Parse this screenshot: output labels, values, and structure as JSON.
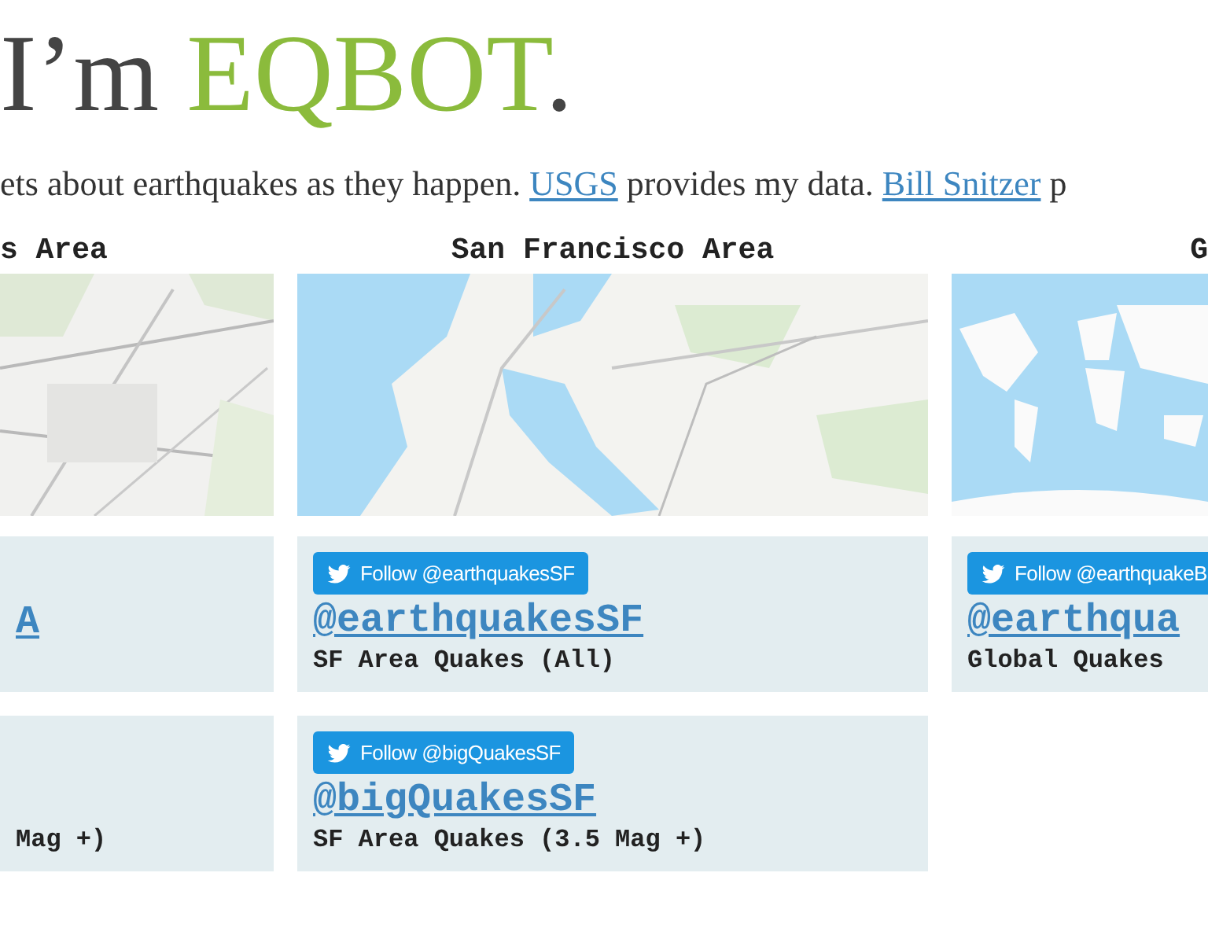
{
  "heading": {
    "prefix": "I’m",
    "name": "EQBOT",
    "suffix": "."
  },
  "intro": [
    {
      "kind": "text",
      "text": "ets about earthquakes as they happen."
    },
    {
      "kind": "link",
      "text": "USGS"
    },
    {
      "kind": "text",
      "text": "provides my data."
    },
    {
      "kind": "link",
      "text": "Bill Snitzer"
    },
    {
      "kind": "text",
      "text": "p"
    }
  ],
  "columns": [
    {
      "title": "s Area",
      "map": {
        "kind": "city"
      },
      "cards": [
        {
          "handle": "A"
        },
        {
          "description": "Mag +)"
        }
      ]
    },
    {
      "title": "San Francisco Area",
      "map": {
        "kind": "bay"
      },
      "cards": [
        {
          "follow_button": "Follow @earthquakesSF",
          "handle": "@earthquakesSF",
          "description": "SF Area Quakes (All)"
        },
        {
          "follow_button": "Follow @bigQuakesSF",
          "handle": "@bigQuakesSF",
          "description": "SF Area Quakes (3.5 Mag +)"
        }
      ]
    },
    {
      "title": "G",
      "map": {
        "kind": "world"
      },
      "cards": [
        {
          "follow_button": "Follow @earthquakeB",
          "handle": "@earthqua",
          "description": "Global Quakes"
        }
      ]
    }
  ]
}
